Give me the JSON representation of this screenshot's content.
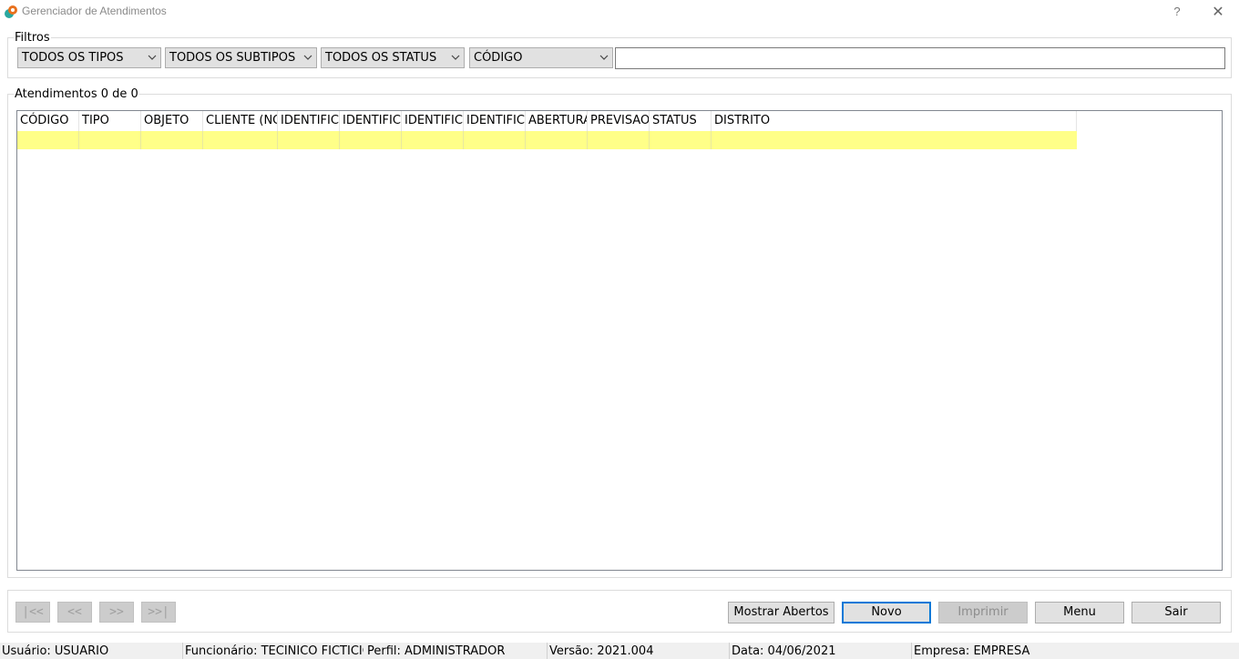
{
  "window": {
    "title": "Gerenciador de Atendimentos",
    "help_label": "?",
    "close_label": "✕",
    "icon": "app-logo-icon",
    "icon_colors": [
      "#e8711e",
      "#2aa8a0"
    ]
  },
  "filters": {
    "group_label": "Filtros",
    "type_value": "TODOS OS TIPOS",
    "subtype_value": "TODOS OS SUBTIPOS",
    "status_value": "TODOS OS STATUS",
    "field_value": "CÓDIGO",
    "search_value": ""
  },
  "results": {
    "group_label": "Atendimentos 0 de 0",
    "columns": [
      "CÓDIGO",
      "TIPO",
      "OBJETO",
      "CLIENTE (NOME)",
      "IDENTIFICAÇÃO",
      "IDENTIFICAÇÃO",
      "IDENTIFICAÇÃO",
      "IDENTIFICAÇÃO",
      "ABERTURA",
      "PREVISAO",
      "STATUS",
      "DISTRITO"
    ],
    "selected_row_color": "#ffff88"
  },
  "navigation": {
    "first": "|<<",
    "prev": "<<",
    "next": ">>",
    "last": ">>|"
  },
  "actions": {
    "show_open": "Mostrar Abertos",
    "new": "Novo",
    "print": "Imprimir",
    "menu": "Menu",
    "exit": "Sair"
  },
  "status": {
    "user": "Usuário: USUARIO",
    "employee": "Funcionário: TECINICO FICTICIO",
    "profile": "Perfil: ADMINISTRADOR",
    "version": "Versão: 2021.004",
    "date": "Data: 04/06/2021",
    "company": "Empresa: EMPRESA"
  },
  "colors": {
    "accent": "#0078d7",
    "button_bg": "#e1e1e1",
    "disabled_bg": "#cccccc"
  }
}
